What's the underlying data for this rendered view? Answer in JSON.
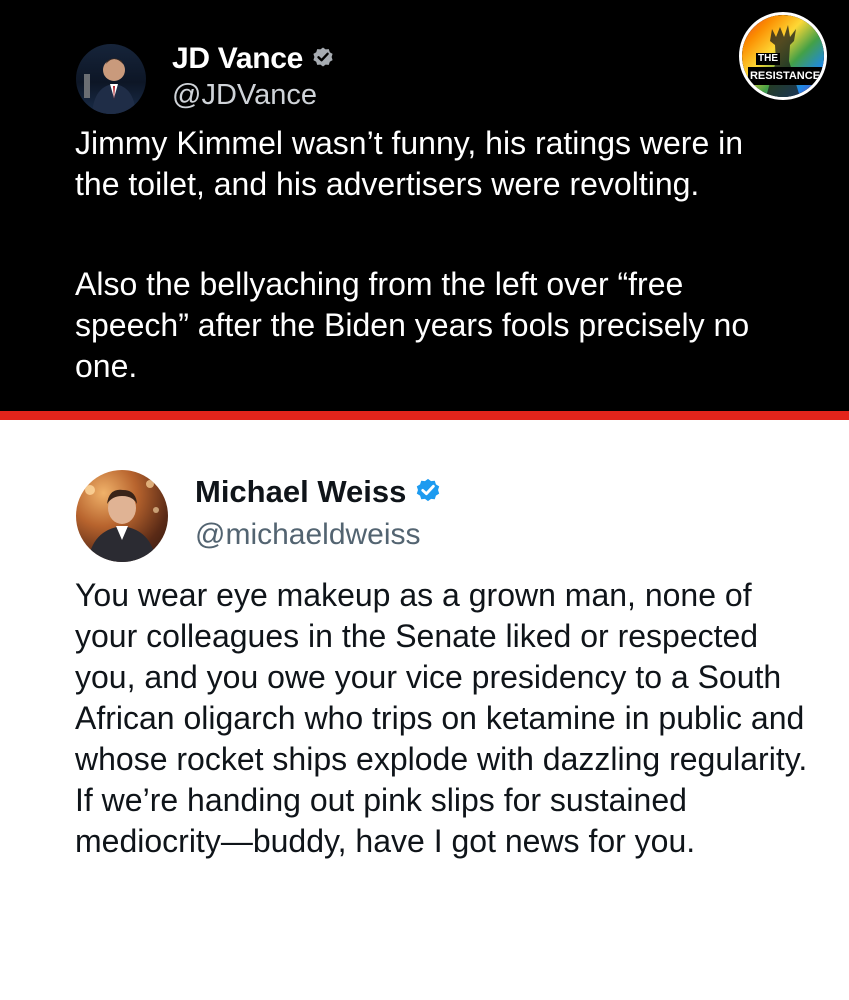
{
  "top_tweet": {
    "name": "JD Vance",
    "handle": "@JDVance",
    "paragraphs": [
      "Jimmy Kimmel wasn’t funny, his ratings were in the toilet, and his advertisers were revolting.",
      "Also the bellyaching from the left over “free speech” after the Biden years fools precisely no one."
    ],
    "verified_icon": "verified-badge-icon"
  },
  "badge": {
    "line1": "THE",
    "line2": "RESISTANCE"
  },
  "bottom_tweet": {
    "name": "Michael Weiss",
    "handle": "@michaeldweiss",
    "paragraphs": [
      "You wear eye makeup as a grown man, none of your colleagues in the Senate liked or respected you, and you owe your vice presidency to a South African oligarch who trips on ketamine in public and whose rocket ships explode with dazzling regularity. If we’re handing out pink slips for sustained mediocrity—buddy, have I got news for you."
    ],
    "verified_icon": "verified-badge-icon"
  },
  "colors": {
    "top_background": "#000000",
    "divider": "#e3241b",
    "verified_blue": "#1d9bf0",
    "verified_grey": "#a7acb2"
  }
}
